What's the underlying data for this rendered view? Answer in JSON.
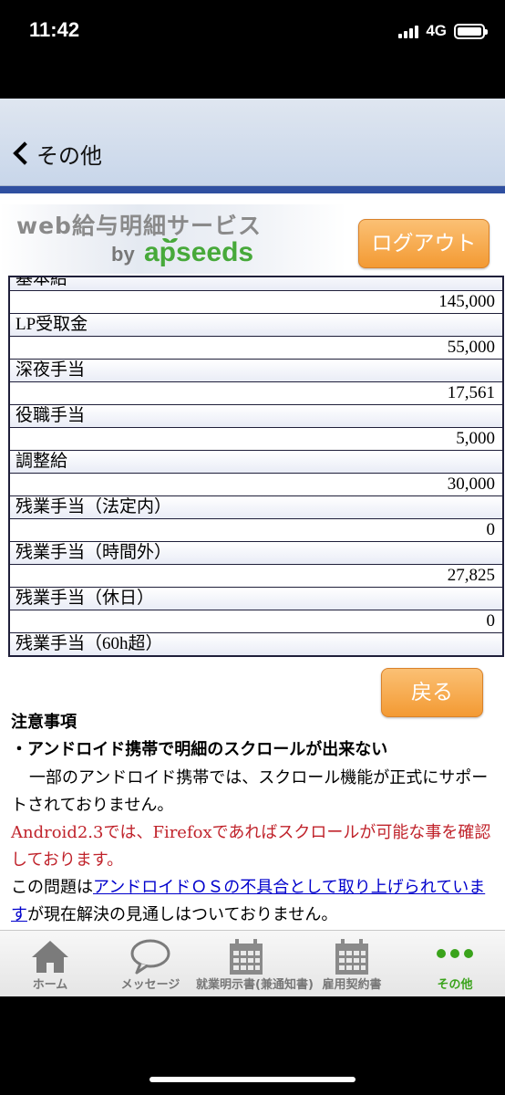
{
  "status_bar": {
    "time": "11:42",
    "network": "4G"
  },
  "nav": {
    "back_label": "その他"
  },
  "header": {
    "brand_title": "web給与明細サービス",
    "brand_by": "by",
    "brand_logo": "apseeds",
    "logout_label": "ログアウト"
  },
  "salary": {
    "partial_top": "基本給",
    "rows": [
      {
        "value": "145,000"
      },
      {
        "label": "LP受取金",
        "value": "55,000"
      },
      {
        "label": "深夜手当",
        "value": "17,561"
      },
      {
        "label": "役職手当",
        "value": "5,000"
      },
      {
        "label": "調整給",
        "value": "30,000"
      },
      {
        "label": "残業手当（法定内）",
        "value": "0"
      },
      {
        "label": "残業手当（時間外）",
        "value": "27,825"
      },
      {
        "label": "残業手当（休日）",
        "value": "0"
      }
    ],
    "partial_bottom": "残業手当（60h超）"
  },
  "back_button_label": "戻る",
  "notes": {
    "heading": "注意事項",
    "bullet": "・アンドロイド携帯で明細のスクロールが出来ない",
    "body": "一部のアンドロイド携帯では、スクロール機能が正式にサポートされておりません。",
    "red": "Android2.3では、Firefoxであればスクロールが可能な事を確認しております。",
    "last_prefix": "この問題は",
    "last_link": "アンドロイドＯＳの不具合として取り上げられています",
    "last_suffix": "が現在解決の見通しはついておりません。"
  },
  "tabs": [
    {
      "label": "ホーム",
      "icon": "home-icon"
    },
    {
      "label": "メッセージ",
      "icon": "speech-bubble-icon"
    },
    {
      "label": "就業明示書(兼通知書)",
      "icon": "calendar-icon"
    },
    {
      "label": "雇用契約書",
      "icon": "calendar-icon"
    },
    {
      "label": "その他",
      "icon": "more-dots-icon",
      "active": true
    }
  ],
  "colors": {
    "accent_green": "#3aa31b",
    "orange": "#f39a33",
    "header_stripe": "#2f4fa0",
    "warning_red": "#c0232b"
  }
}
